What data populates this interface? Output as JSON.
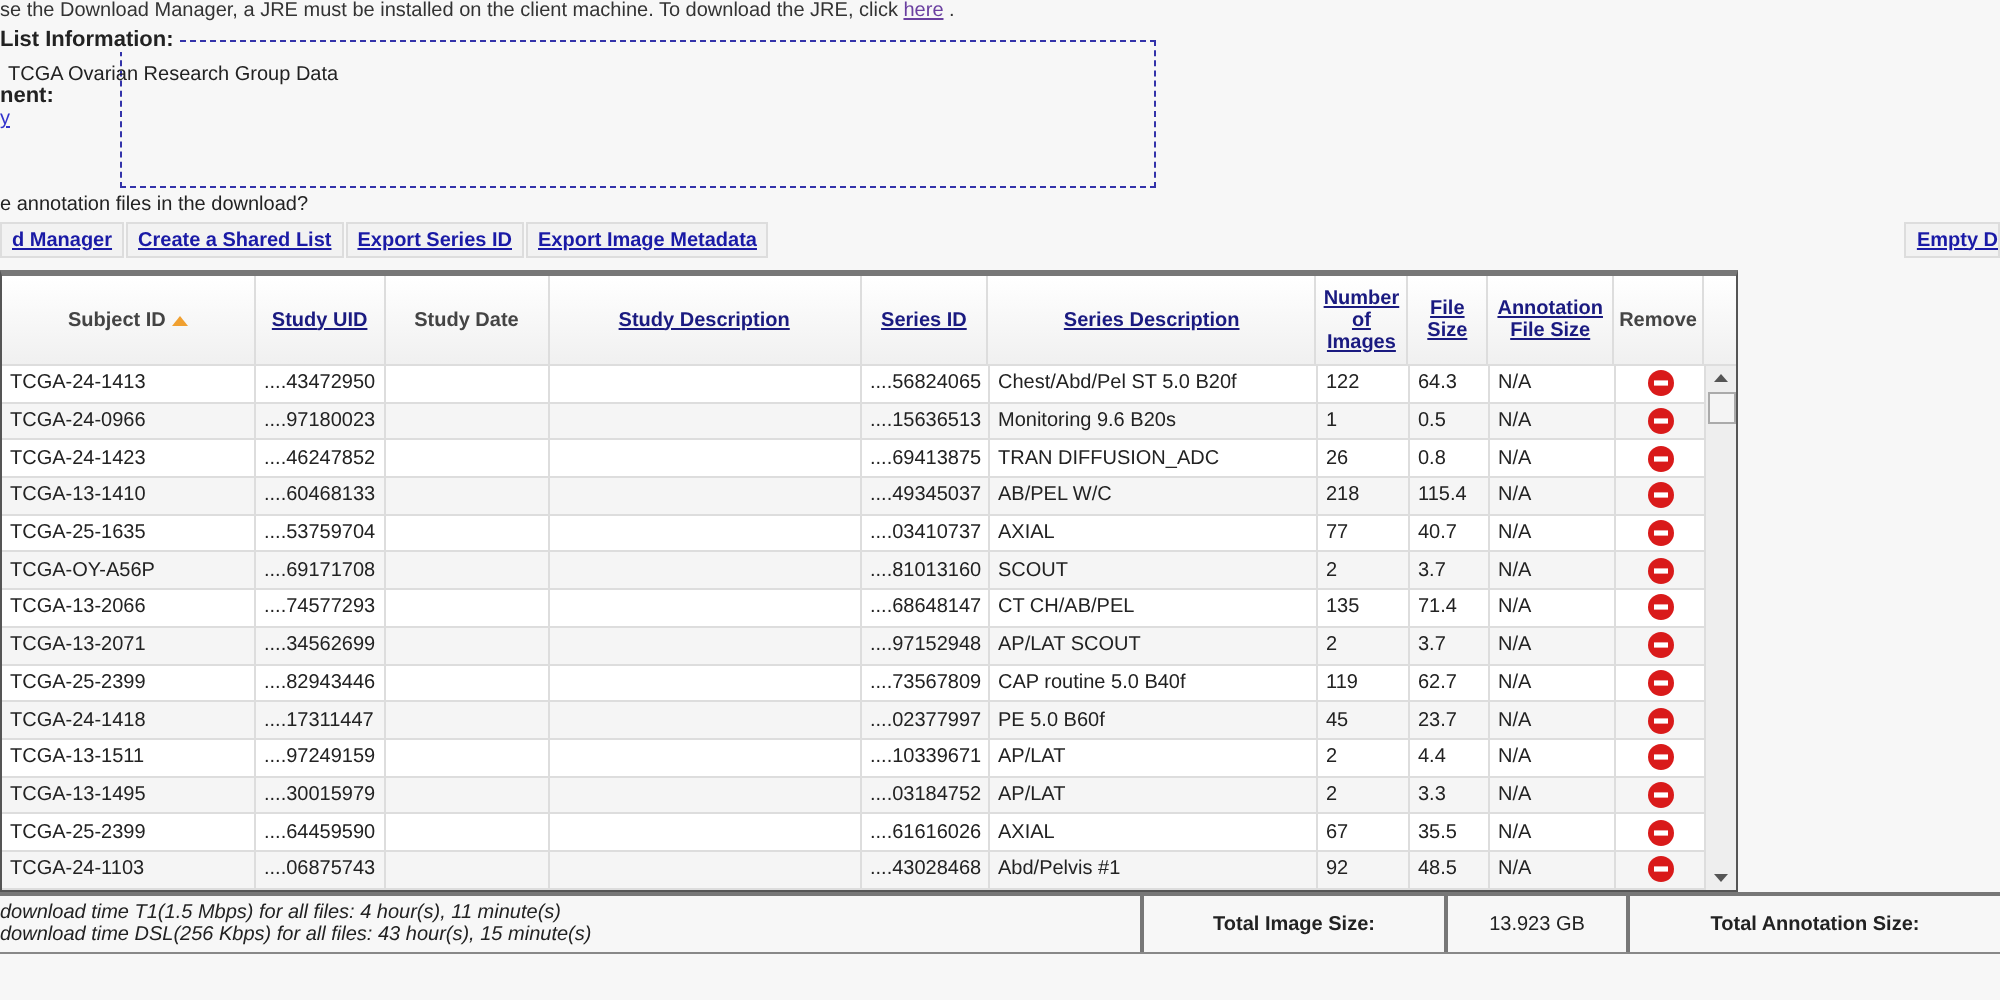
{
  "notice": {
    "text": "se the Download Manager, a JRE must be installed on the client machine. To download the JRE, click ",
    "link": "here",
    "tail": " ."
  },
  "list_info": {
    "legend": "List Information:",
    "name": "TCGA Ovarian Research Group Data",
    "label": "nent:",
    "link": "y"
  },
  "annotation_question": "e annotation files in the download?",
  "actions": [
    "d Manager",
    "Create a Shared List",
    "Export Series ID",
    "Export Image Metadata"
  ],
  "empty_button": "Empty D",
  "table": {
    "columns": [
      {
        "label": "Subject ID",
        "kind": "plain",
        "sorted": true
      },
      {
        "label": "Study UID",
        "kind": "link",
        "sorted": false
      },
      {
        "label": "Study Date",
        "kind": "plain",
        "sorted": false
      },
      {
        "label": "Study Description",
        "kind": "link",
        "sorted": false
      },
      {
        "label": "Series ID",
        "kind": "link",
        "sorted": false
      },
      {
        "label": "Series Description",
        "kind": "link",
        "sorted": false
      },
      {
        "label": "Number of Images",
        "kind": "link",
        "sorted": false
      },
      {
        "label": "File Size",
        "kind": "link",
        "sorted": false
      },
      {
        "label": "Annotation File Size",
        "kind": "link",
        "sorted": false
      },
      {
        "label": "Remove",
        "kind": "plain",
        "sorted": false
      }
    ],
    "rows": [
      [
        "TCGA-24-1413",
        "....43472950",
        "",
        "",
        "....56824065",
        "Chest/Abd/Pel ST 5.0 B20f",
        "122",
        "64.3",
        "N/A"
      ],
      [
        "TCGA-24-0966",
        "....97180023",
        "",
        "",
        "....15636513",
        "Monitoring 9.6 B20s",
        "1",
        "0.5",
        "N/A"
      ],
      [
        "TCGA-24-1423",
        "....46247852",
        "",
        "",
        "....69413875",
        "TRAN DIFFUSION_ADC",
        "26",
        "0.8",
        "N/A"
      ],
      [
        "TCGA-13-1410",
        "....60468133",
        "",
        "",
        "....49345037",
        "AB/PEL W/C",
        "218",
        "115.4",
        "N/A"
      ],
      [
        "TCGA-25-1635",
        "....53759704",
        "",
        "",
        "....03410737",
        "AXIAL",
        "77",
        "40.7",
        "N/A"
      ],
      [
        "TCGA-OY-A56P",
        "....69171708",
        "",
        "",
        "....81013160",
        "SCOUT",
        "2",
        "3.7",
        "N/A"
      ],
      [
        "TCGA-13-2066",
        "....74577293",
        "",
        "",
        "....68648147",
        "CT CH/AB/PEL",
        "135",
        "71.4",
        "N/A"
      ],
      [
        "TCGA-13-2071",
        "....34562699",
        "",
        "",
        "....97152948",
        "AP/LAT SCOUT",
        "2",
        "3.7",
        "N/A"
      ],
      [
        "TCGA-25-2399",
        "....82943446",
        "",
        "",
        "....73567809",
        "CAP routine 5.0 B40f",
        "119",
        "62.7",
        "N/A"
      ],
      [
        "TCGA-24-1418",
        "....17311447",
        "",
        "",
        "....02377997",
        "PE 5.0 B60f",
        "45",
        "23.7",
        "N/A"
      ],
      [
        "TCGA-13-1511",
        "....97249159",
        "",
        "",
        "....10339671",
        "AP/LAT",
        "2",
        "4.4",
        "N/A"
      ],
      [
        "TCGA-13-1495",
        "....30015979",
        "",
        "",
        "....03184752",
        "AP/LAT",
        "2",
        "3.3",
        "N/A"
      ],
      [
        "TCGA-25-2399",
        "....64459590",
        "",
        "",
        "....61616026",
        "AXIAL",
        "67",
        "35.5",
        "N/A"
      ],
      [
        "TCGA-24-1103",
        "....06875743",
        "",
        "",
        "....43028468",
        "Abd/Pelvis #1",
        "92",
        "48.5",
        "N/A"
      ]
    ]
  },
  "footer": {
    "times": [
      "download time T1(1.5 Mbps) for all files: 4 hour(s), 11 minute(s)",
      "download time DSL(256 Kbps) for all files: 43 hour(s), 15 minute(s)"
    ],
    "image_size_label": "Total Image Size:",
    "image_size": "13.923 GB",
    "annotation_size_label": "Total Annotation Size:"
  }
}
